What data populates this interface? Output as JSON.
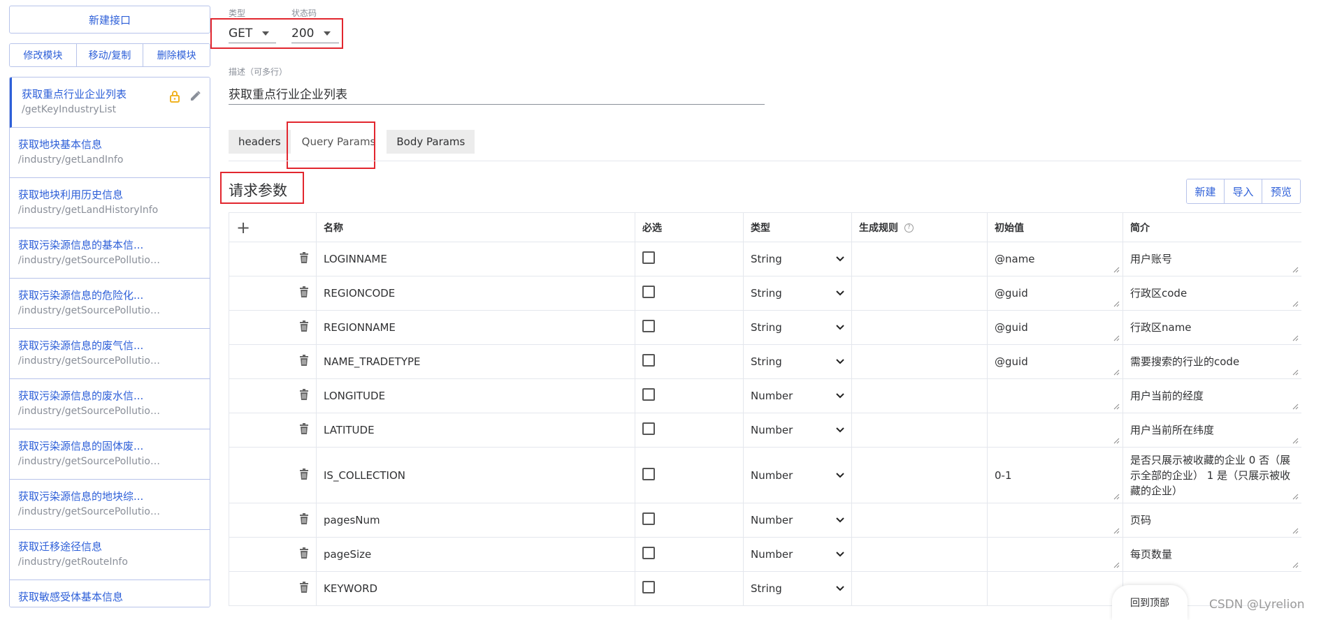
{
  "sidebar": {
    "new_button": "新建接口",
    "module_buttons": [
      "修改模块",
      "移动/复制",
      "删除模块"
    ],
    "items": [
      {
        "name": "获取重点行业企业列表",
        "path": "/getKeyIndustryList"
      },
      {
        "name": "获取地块基本信息",
        "path": "/industry/getLandInfo"
      },
      {
        "name": "获取地块利用历史信息",
        "path": "/industry/getLandHistoryInfo"
      },
      {
        "name": "获取污染源信息的基本信...",
        "path": "/industry/getSourcePollution..."
      },
      {
        "name": "获取污染源信息的危险化...",
        "path": "/industry/getSourcePollution..."
      },
      {
        "name": "获取污染源信息的废气信...",
        "path": "/industry/getSourcePollution..."
      },
      {
        "name": "获取污染源信息的废水信...",
        "path": "/industry/getSourcePollution..."
      },
      {
        "name": "获取污染源信息的固体废...",
        "path": "/industry/getSourcePollution..."
      },
      {
        "name": "获取污染源信息的地块综...",
        "path": "/industry/getSourcePollution..."
      },
      {
        "name": "获取迁移途径信息",
        "path": "/industry/getRouteInfo"
      },
      {
        "name": "获取敏感受体基本信息",
        "path": ""
      }
    ]
  },
  "form": {
    "type_label": "类型",
    "type_value": "GET",
    "status_label": "状态码",
    "status_value": "200",
    "desc_label": "描述（可多行）",
    "desc_value": "获取重点行业企业列表"
  },
  "tabs": [
    "headers",
    "Query Params",
    "Body Params"
  ],
  "section_title": "请求参数",
  "actions": [
    "新建",
    "导入",
    "预览"
  ],
  "table": {
    "plus": "+",
    "headers": [
      "名称",
      "必选",
      "类型",
      "生成规则",
      "初始值",
      "简介"
    ],
    "rule_help": "?",
    "rows": [
      {
        "name": "LOGINNAME",
        "type": "String",
        "init": "@name",
        "desc": "用户账号"
      },
      {
        "name": "REGIONCODE",
        "type": "String",
        "init": "@guid",
        "desc": "行政区code"
      },
      {
        "name": "REGIONNAME",
        "type": "String",
        "init": "@guid",
        "desc": "行政区name"
      },
      {
        "name": "NAME_TRADETYPE",
        "type": "String",
        "init": "@guid",
        "desc": "需要搜索的行业的code"
      },
      {
        "name": "LONGITUDE",
        "type": "Number",
        "init": "",
        "desc": "用户当前的经度"
      },
      {
        "name": "LATITUDE",
        "type": "Number",
        "init": "",
        "desc": "用户当前所在纬度"
      },
      {
        "name": "IS_COLLECTION",
        "type": "Number",
        "init": "0-1",
        "desc": "是否只展示被收藏的企业 0 否（展示全部的企业） 1 是（只展示被收藏的企业）"
      },
      {
        "name": "pagesNum",
        "type": "Number",
        "init": "",
        "desc": "页码"
      },
      {
        "name": "pageSize",
        "type": "Number",
        "init": "",
        "desc": "每页数量"
      },
      {
        "name": "KEYWORD",
        "type": "String",
        "init": "",
        "desc": ""
      }
    ]
  },
  "back_to_top": "回到顶部",
  "watermark": "CSDN @Lyrelion",
  "colors": {
    "accent": "#2d5fd8",
    "highlight": "#e2262e",
    "border": "#b7c3ea"
  }
}
